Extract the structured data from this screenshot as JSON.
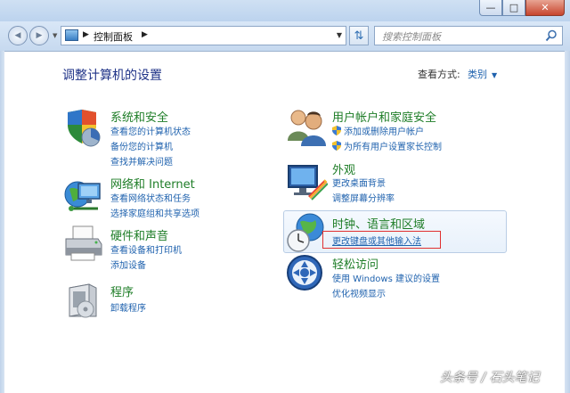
{
  "window": {
    "min_symbol": "—",
    "max_symbol": "□",
    "close_symbol": "✕"
  },
  "nav": {
    "back_symbol": "◀",
    "forward_symbol": "▶",
    "breadcrumb": "控制面板",
    "search_placeholder": "搜索控制面板"
  },
  "header": {
    "title": "调整计算机的设置",
    "view_by_label": "查看方式:",
    "view_by_value": "类别"
  },
  "categories": {
    "system": {
      "title": "系统和安全",
      "icon": "shield-pie-icon",
      "links": [
        "查看您的计算机状态",
        "备份您的计算机",
        "查找并解决问题"
      ]
    },
    "network": {
      "title": "网络和 Internet",
      "icon": "network-globe-icon",
      "links": [
        "查看网络状态和任务",
        "选择家庭组和共享选项"
      ]
    },
    "hardware": {
      "title": "硬件和声音",
      "icon": "printer-icon",
      "links": [
        "查看设备和打印机",
        "添加设备"
      ]
    },
    "programs": {
      "title": "程序",
      "icon": "programs-box-icon",
      "links": [
        "卸载程序"
      ]
    },
    "users": {
      "title": "用户帐户和家庭安全",
      "icon": "users-icon",
      "links": [
        "添加或删除用户帐户",
        "为所有用户设置家长控制"
      ]
    },
    "appearance": {
      "title": "外观",
      "icon": "monitor-brush-icon",
      "links": [
        "更改桌面背景",
        "调整屏幕分辨率"
      ]
    },
    "clock": {
      "title": "时钟、语言和区域",
      "icon": "clock-globe-icon",
      "links": [
        "更改键盘或其他输入法"
      ]
    },
    "ease": {
      "title": "轻松访问",
      "icon": "ease-of-access-icon",
      "links": [
        "使用 Windows 建议的设置",
        "优化视频显示"
      ]
    }
  },
  "watermark": "头条号 / 石头笔记",
  "colors": {
    "category_title": "#1e7d27",
    "link": "#1f62ae",
    "heading": "#1e3287",
    "highlight_border": "#e03030"
  }
}
